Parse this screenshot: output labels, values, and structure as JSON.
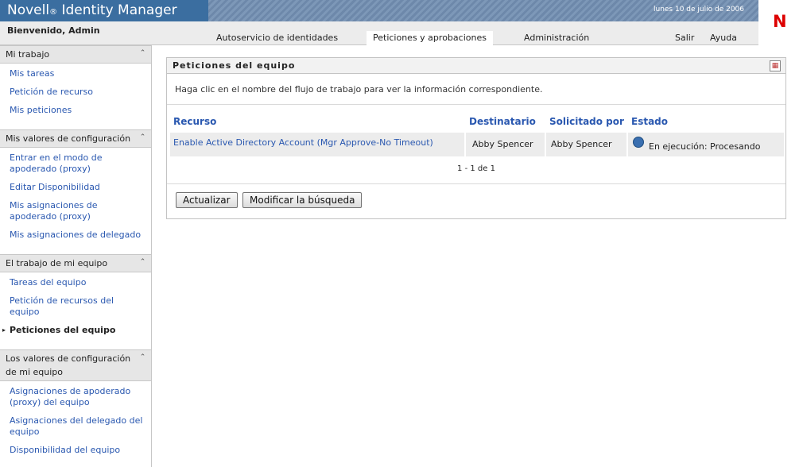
{
  "header": {
    "brand": "Novell",
    "brand_mark": "®",
    "brand_product": "Identity Manager",
    "date": "lunes 10 de julio de 2006",
    "welcome": "Bienvenido, Admin",
    "logo_letter": "N",
    "tabs": [
      {
        "label": "Autoservicio de identidades",
        "active": false
      },
      {
        "label": "Peticiones y aprobaciones",
        "active": true
      },
      {
        "label": "Administración",
        "active": false
      }
    ],
    "links": {
      "logout": "Salir",
      "help": "Ayuda"
    }
  },
  "sidebar": {
    "sections": [
      {
        "title": "Mi trabajo",
        "items": [
          "Mis tareas",
          "Petición de recurso",
          "Mis peticiones"
        ]
      },
      {
        "title": "Mis valores de configuración",
        "items": [
          "Entrar en el modo de apoderado (proxy)",
          "Editar Disponibilidad",
          "Mis asignaciones de apoderado (proxy)",
          "Mis asignaciones de delegado"
        ]
      },
      {
        "title": "El trabajo de mi equipo",
        "items": [
          "Tareas del equipo",
          "Petición de recursos del equipo",
          "Peticiones del equipo"
        ],
        "current": "Peticiones del equipo"
      },
      {
        "title": "Los valores de configuración de mi equipo",
        "items": [
          "Asignaciones de apoderado (proxy) del equipo",
          "Asignaciones del delegado del equipo",
          "Disponibilidad del equipo"
        ]
      }
    ]
  },
  "panel": {
    "title": "Peticiones del equipo",
    "description": "Haga clic en el nombre del flujo de trabajo para ver la información correspondiente.",
    "columns": [
      "Recurso",
      "Destinatario",
      "Solicitado por",
      "Estado"
    ],
    "rows": [
      {
        "resource": "Enable Active Directory Account (Mgr Approve-No Timeout)",
        "recipient": "Abby Spencer",
        "requested_by": "Abby Spencer",
        "status": "En ejecución: Procesando"
      }
    ],
    "count": "1 - 1 de 1",
    "buttons": {
      "refresh": "Actualizar",
      "modify_search": "Modificar la búsqueda"
    }
  },
  "colors": {
    "banner": "#3b6ea0",
    "link": "#2a58b0",
    "logo": "#dd0000"
  }
}
